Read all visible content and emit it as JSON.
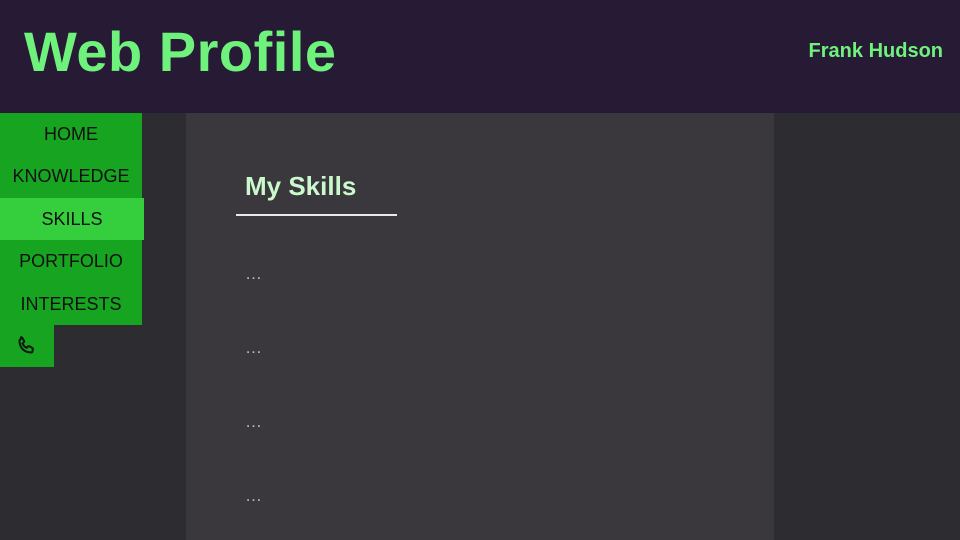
{
  "header": {
    "title": "Web Profile",
    "user_name": "Frank Hudson"
  },
  "nav": {
    "items": [
      {
        "label": "HOME",
        "active": false
      },
      {
        "label": "KNOWLEDGE",
        "active": false
      },
      {
        "label": "SKILLS",
        "active": true
      },
      {
        "label": "PORTFOLIO",
        "active": false
      },
      {
        "label": "INTERESTS",
        "active": false
      }
    ],
    "contact_icon": "phone-icon"
  },
  "main": {
    "section_title": "My Skills",
    "skills": [
      "…",
      "…",
      "…",
      "…"
    ]
  },
  "colors": {
    "header_bg": "#261a35",
    "accent_green": "#6ff27c",
    "nav_bg": "#17a521",
    "nav_active_bg": "#35cf3d",
    "main_bg": "#3a383d",
    "page_bg": "#2d2c30"
  }
}
